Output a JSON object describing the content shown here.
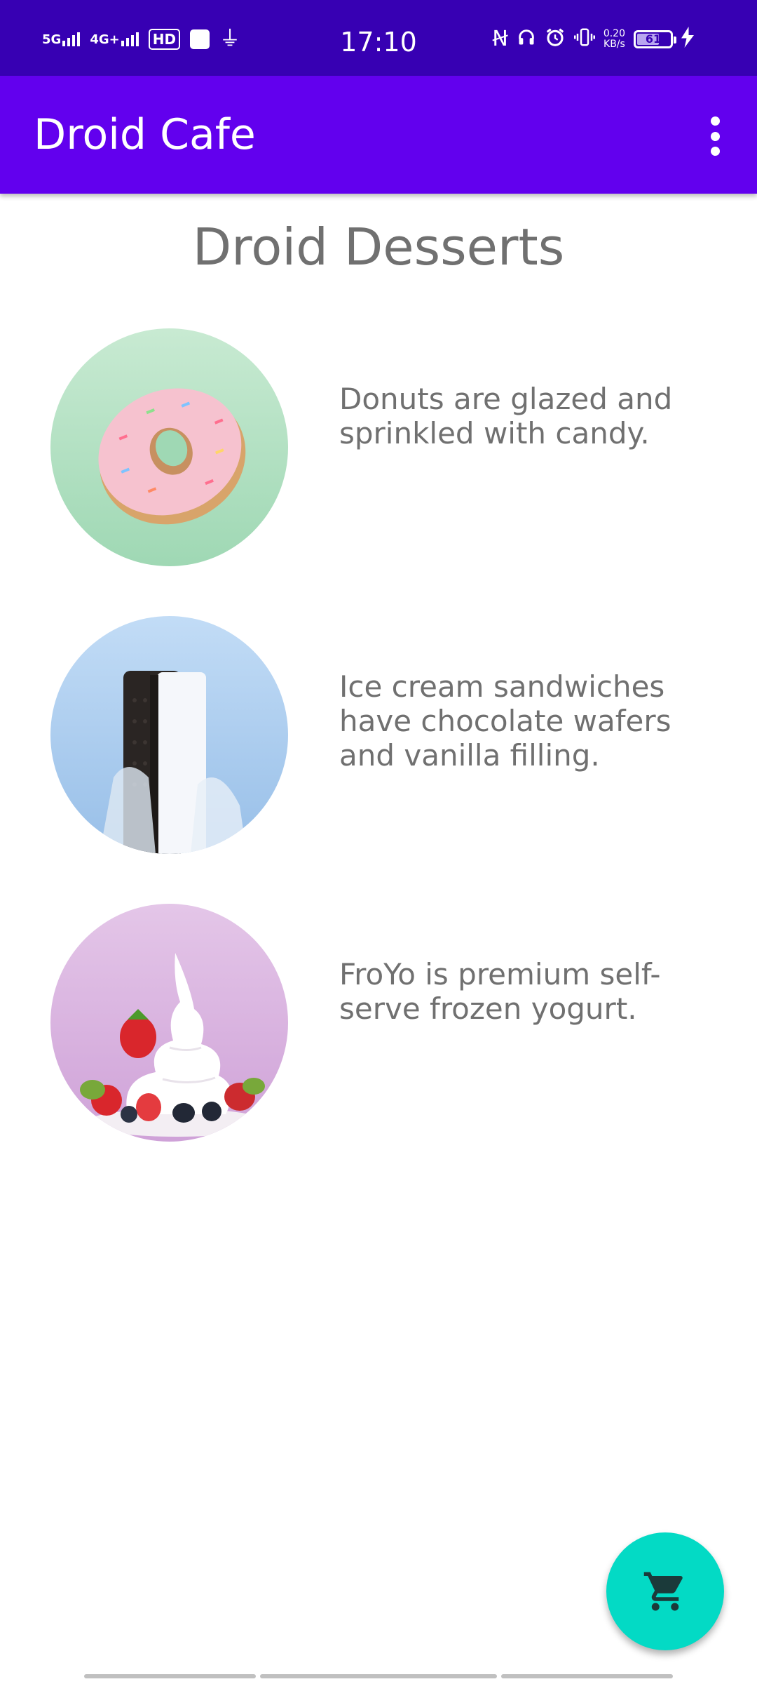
{
  "status_bar": {
    "time": "17:10",
    "network_1": "5G",
    "network_2": "4G+",
    "hd": "HD",
    "speed_value": "0.20",
    "speed_unit": "KB/s",
    "battery_level": "61",
    "icons": [
      "signal-icon",
      "hd-voice-icon",
      "app-notification-icon",
      "usb-icon",
      "nfc-icon",
      "headphones-icon",
      "alarm-icon",
      "vibrate-icon",
      "battery-icon",
      "charging-icon"
    ]
  },
  "app_bar": {
    "title": "Droid Cafe",
    "background": "#6200ee",
    "status_background": "#3700b3"
  },
  "main": {
    "heading": "Droid Desserts",
    "items": [
      {
        "image": "donut-image",
        "description": "Donuts are glazed and sprinkled with candy."
      },
      {
        "image": "ice-cream-sandwich-image",
        "description": "Ice cream sandwiches have chocolate wafers and vanilla filling."
      },
      {
        "image": "froyo-image",
        "description": "FroYo is premium self-serve frozen yogurt."
      }
    ]
  },
  "fab": {
    "icon": "shopping-cart-icon",
    "color": "#03dac5"
  }
}
